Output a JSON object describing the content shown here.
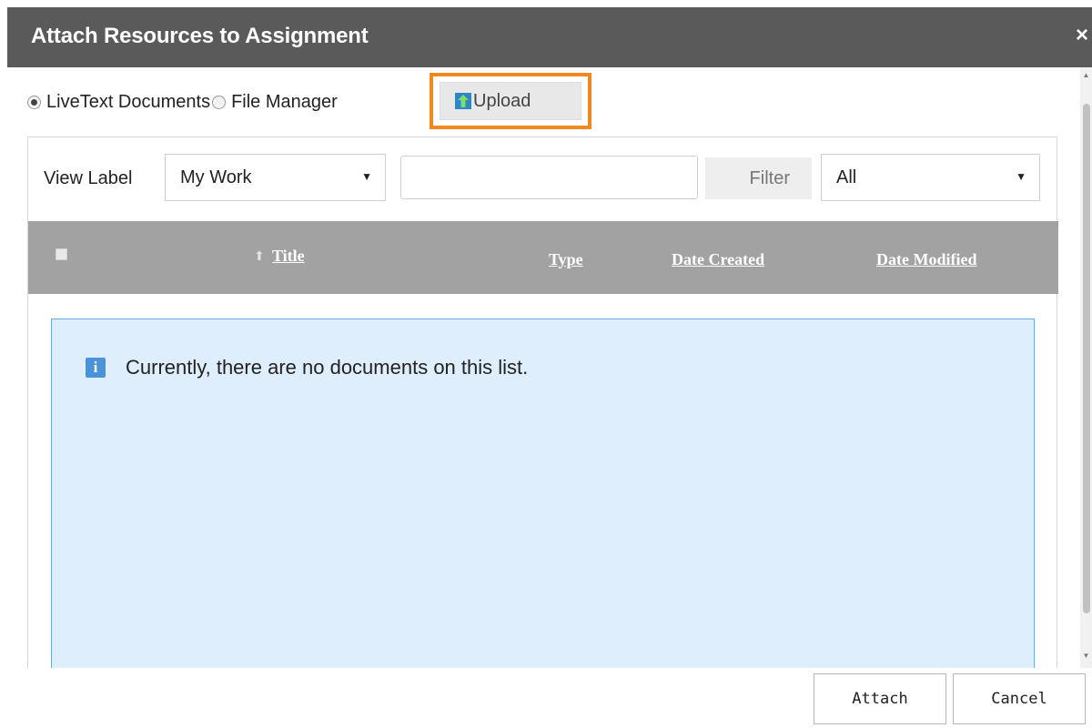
{
  "dialog": {
    "title": "Attach Resources to Assignment",
    "close_glyph": "×"
  },
  "source": {
    "options": [
      {
        "label": "LiveText Documents",
        "checked": true
      },
      {
        "label": "File Manager",
        "checked": false
      }
    ],
    "upload_label": "Upload",
    "upload_icon": "upload-arrow-icon",
    "highlight_color": "#f08a1e"
  },
  "toolbar": {
    "view_label": "View Label",
    "view_select_value": "My Work",
    "search_value": "",
    "filter_label": "Filter",
    "type_select_value": "All"
  },
  "table": {
    "columns": [
      "Title",
      "Type",
      "Date Created",
      "Date Modified"
    ],
    "sorted_column": "Title",
    "rows": []
  },
  "empty_state": {
    "icon": "info-icon",
    "glyph": "i",
    "message": "Currently, there are no documents on this list."
  },
  "footer": {
    "attach_label": "Attach",
    "cancel_label": "Cancel"
  },
  "colors": {
    "titlebar": "#5a5a5a",
    "table_header": "#a2a2a2",
    "empty_bg": "#dfeefc",
    "empty_border": "#6fa8de"
  }
}
